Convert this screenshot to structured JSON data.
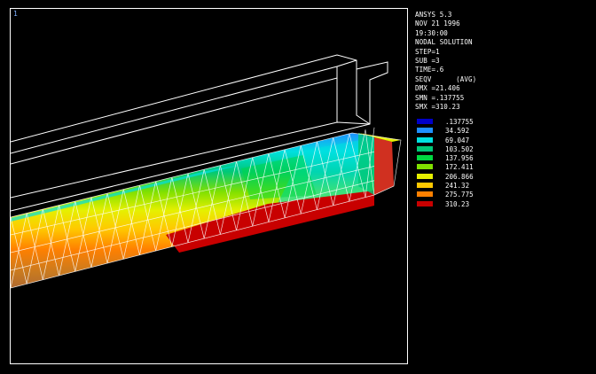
{
  "viewport": {
    "number": "1"
  },
  "header": {
    "lines": [
      "ANSYS 5.3",
      "NOV 21 1996",
      "19:30:00",
      "NODAL SOLUTION",
      "STEP=1",
      "SUB =3",
      "TIME=.6",
      "SEQV      (AVG)",
      "DMX =21.406",
      "SMN =.137755",
      "SMX =310.23"
    ]
  },
  "legend": {
    "entries": [
      {
        "value": ".137755",
        "color": "#0000c8"
      },
      {
        "value": "34.592",
        "color": "#1e90ff"
      },
      {
        "value": "69.047",
        "color": "#00e0e0"
      },
      {
        "value": "103.502",
        "color": "#00c878"
      },
      {
        "value": "137.956",
        "color": "#00d840"
      },
      {
        "value": "172.411",
        "color": "#80e000"
      },
      {
        "value": "206.866",
        "color": "#e6f000"
      },
      {
        "value": "241.32",
        "color": "#ffc800"
      },
      {
        "value": "275.775",
        "color": "#ff8000"
      },
      {
        "value": "310.23",
        "color": "#c80000"
      }
    ]
  }
}
